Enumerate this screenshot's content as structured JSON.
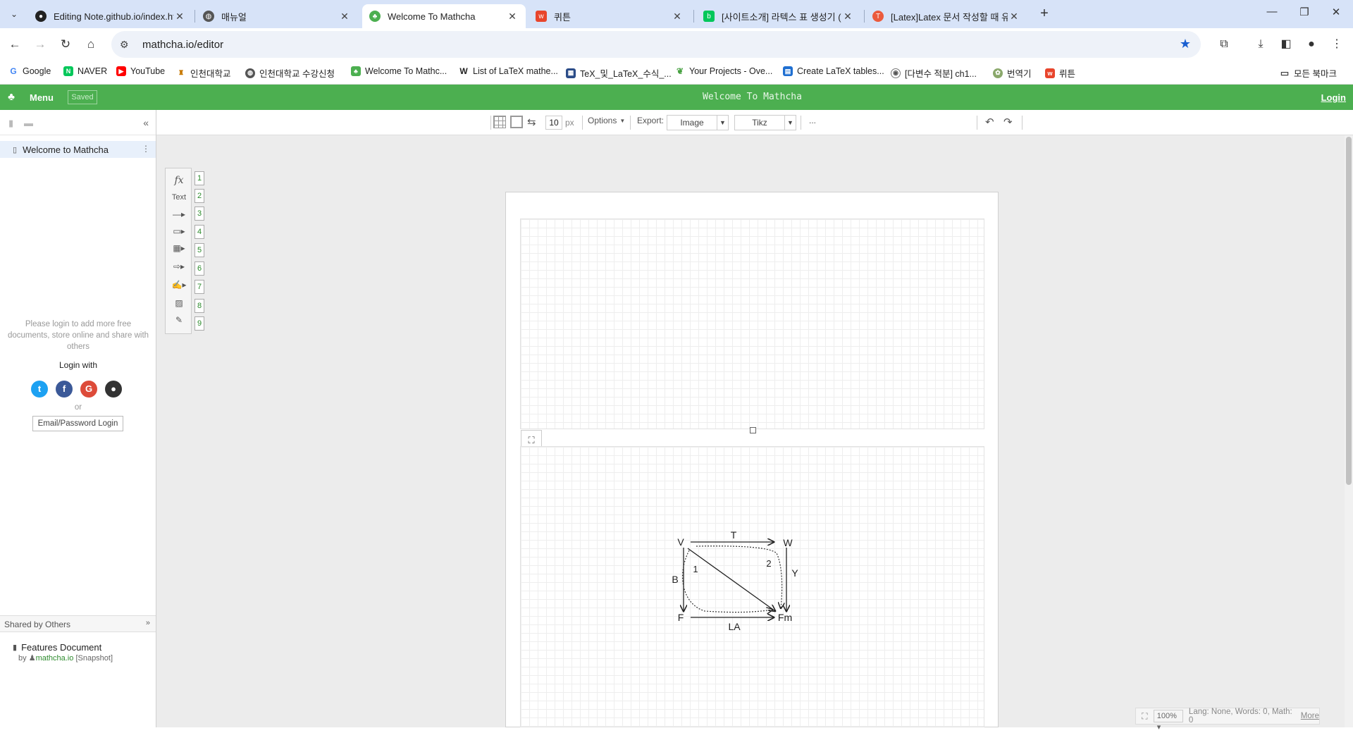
{
  "browser": {
    "tabs": [
      {
        "title": "Editing Note.github.io/index.ht",
        "icon": "github-icon",
        "active": false
      },
      {
        "title": "매뉴얼",
        "icon": "globe-icon",
        "active": false
      },
      {
        "title": "Welcome To Mathcha",
        "icon": "mathcha-icon",
        "active": true
      },
      {
        "title": "퀴튼",
        "icon": "wrtn-icon",
        "active": false
      },
      {
        "title": "[사이트소개] 라텍스 표 생성기 (",
        "icon": "naver-blog-icon",
        "active": false
      },
      {
        "title": "[Latex]Latex 문서 작성할 때 유",
        "icon": "tistory-icon",
        "active": false
      }
    ],
    "url": "mathcha.io/editor",
    "bookmarks": [
      "Google",
      "NAVER",
      "YouTube",
      "인천대학교",
      "인천대학교 수강신청",
      "Welcome To Mathc...",
      "List of LaTeX mathe...",
      "TeX_및_LaTeX_수식_...",
      "Your Projects - Ove...",
      "Create LaTeX tables...",
      "[다변수 적분] ch1...",
      "번역기",
      "뤼튼"
    ],
    "all_bookmarks": "모든 북마크"
  },
  "app": {
    "menu_label": "Menu",
    "saved_label": "Saved",
    "title": "Welcome To Mathcha",
    "login_label": "Login"
  },
  "sidebar": {
    "document": "Welcome to Mathcha",
    "login_message": "Please login to add more free documents, store online and share with others",
    "login_with": "Login with",
    "or": "or",
    "email_login": "Email/Password Login",
    "shared_header": "Shared by Others",
    "shared_doc": "Features Document",
    "shared_by": "by",
    "shared_author": "mathcha.io",
    "shared_tag": "[Snapshot]"
  },
  "editor_toolbar": {
    "grid_size": "10",
    "unit": "px",
    "options_label": "Options",
    "export_label": "Export:",
    "export_format": "Image",
    "export_target": "Tikz",
    "more": "..."
  },
  "palette": {
    "fx": "fx",
    "text": "Text",
    "numbers": [
      "1",
      "2",
      "3",
      "4",
      "5",
      "6",
      "7",
      "8",
      "9"
    ]
  },
  "diagram": {
    "nodes": {
      "tl": "V",
      "tr": "W",
      "bl": "F",
      "br": "Fm"
    },
    "arrows": {
      "top": "T",
      "left": "B",
      "right": "Y",
      "bottom": "LA"
    },
    "cells": {
      "lower": "1",
      "upper": "2"
    }
  },
  "statusbar": {
    "zoom": "100%",
    "info": "Lang: None, Words: 0, Math: 0",
    "more": "More"
  },
  "colors": {
    "brand_green": "#4caf50",
    "tab_strip": "#d7e3f8"
  }
}
